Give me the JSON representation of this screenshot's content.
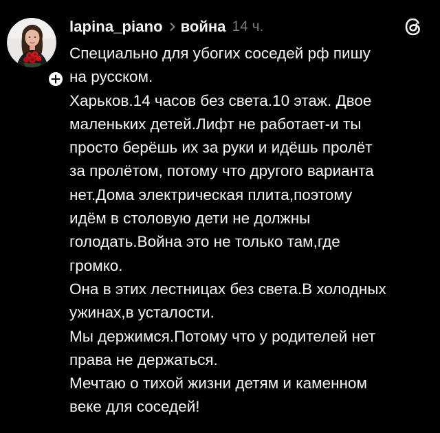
{
  "post": {
    "author": {
      "username": "lapina_piano",
      "avatar_icon": "avatar-woman-with-red-roses",
      "follow_icon": "plus-icon"
    },
    "topic": "война",
    "time": "14 ч.",
    "app_icon": "threads-logo-icon",
    "lines": [
      "Специально для убогих соседей рф пишу",
      "на русском.",
      "Харьков.14 часов без света.10 этаж. Двое",
      "маленьких детей.Лифт не работает-и ты",
      "просто берёшь их за руки и идёшь пролёт",
      "за пролётом, потому что другого варианта",
      "нет.Дома электрическая плита,поэтому",
      "идём в столовую дети не должны",
      "голодать.Война это не только там,где",
      "громко.",
      "Она в этих лестницах без света.В холодных",
      "ужинах,в усталости.",
      "Мы держимся.Потому что у родителей нет",
      "права не держаться.",
      "Мечтаю о тихой жизни детям и каменном",
      "веке для соседей!"
    ]
  },
  "colors": {
    "background": "#000000",
    "text_primary": "#f3f5f7",
    "text_secondary": "#777777",
    "badge": "#ffffff"
  }
}
